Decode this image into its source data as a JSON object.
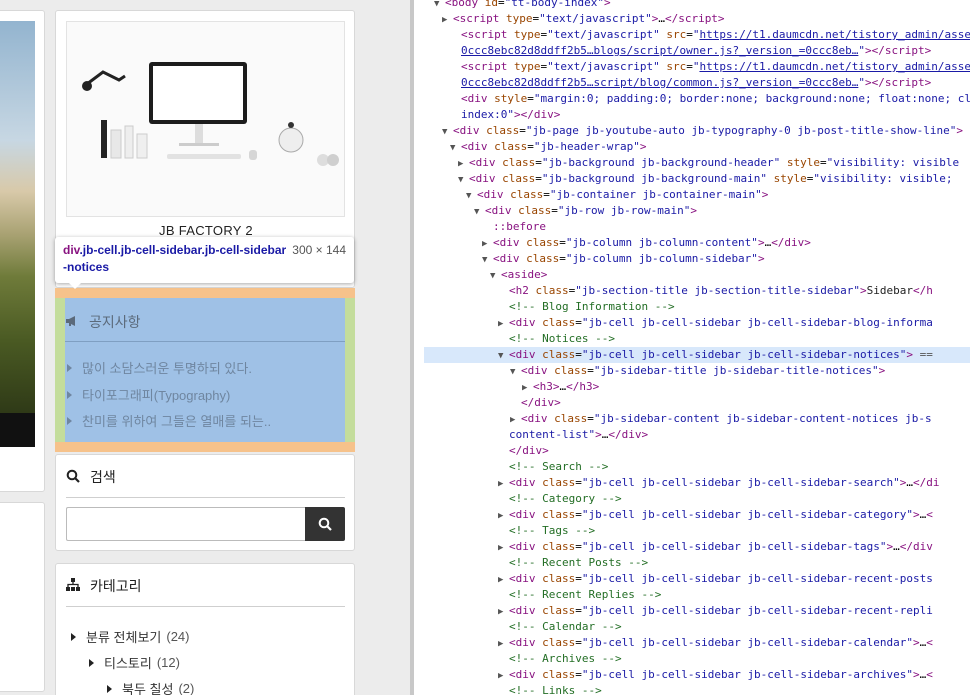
{
  "blog": {
    "logo_name": "JB FACTORY 2",
    "tooltip": {
      "tag": "div",
      "classes": ".jb-cell.jb-cell-sidebar.jb-cell-sidebar-notices",
      "size": "300 × 144"
    },
    "notices": {
      "title": "공지사항",
      "items": [
        "많이 소담스러운 투명하되 있다.",
        "타이포그래피(Typography)",
        "찬미를 위하여 그들은 열매를 되는.."
      ]
    },
    "search": {
      "title": "검색",
      "placeholder": ""
    },
    "categories": {
      "title": "카테고리",
      "items": [
        {
          "label": "분류 전체보기",
          "count": "(24)"
        },
        {
          "label": "티스토리",
          "count": "(12)"
        },
        {
          "label": "북두 칠성",
          "count": "(2)"
        }
      ]
    }
  },
  "colors": {
    "tag": "#881280",
    "attr_name": "#994500",
    "attr_value": "#1a1aa6",
    "comment": "#236e25",
    "margin_highlight": "#f6c28b",
    "padding_highlight": "#c4dd9c",
    "content_highlight": "#9fc1e6"
  },
  "devtools": {
    "lines": [
      {
        "arrow": "▼",
        "html": "<span class='tag'>&lt;body</span> <span class='an'>id</span>=<span class='av'>\"tt-body-index\"</span><span class='tag'>&gt;</span>"
      },
      {
        "arrow": "▶",
        "html": "<span class='tag'>&lt;script</span> <span class='an'>type</span>=<span class='av'>\"text/javascript\"</span><span class='tag'>&gt;</span>…<span class='tag'>&lt;/script&gt;</span>"
      },
      {
        "arrow": "",
        "html": "<span class='tag'>&lt;script</span> <span class='an'>type</span>=<span class='av'>\"text/javascript\"</span> <span class='an'>src</span>=<span class='av'>\"<span class='lk'>https://t1.daumcdn.net/tistory_admin/asse</span></span>"
      },
      {
        "arrow": "",
        "html": "<span class='lk'>0ccc8ebc82d8ddff2b5…blogs/script/owner.js?_version_=0ccc8eb…</span><span class='av'>\"</span><span class='tag'>&gt;&lt;/script&gt;</span>"
      },
      {
        "arrow": "",
        "html": "<span class='tag'>&lt;script</span> <span class='an'>type</span>=<span class='av'>\"text/javascript\"</span> <span class='an'>src</span>=<span class='av'>\"<span class='lk'>https://t1.daumcdn.net/tistory_admin/asse</span></span>"
      },
      {
        "arrow": "",
        "html": "<span class='lk'>0ccc8ebc82d8ddff2b5…script/blog/common.js?_version_=0ccc8eb…</span><span class='av'>\"</span><span class='tag'>&gt;&lt;/script&gt;</span>"
      },
      {
        "arrow": "",
        "html": "<span class='tag'>&lt;div</span> <span class='an'>style</span>=<span class='av'>\"margin:0; padding:0; border:none; background:none; float:none; cl</span>"
      },
      {
        "arrow": "",
        "html": "<span class='av'>index:0\"</span><span class='tag'>&gt;&lt;/div&gt;</span>"
      },
      {
        "arrow": "▼",
        "html": "<span class='tag'>&lt;div</span> <span class='an'>class</span>=<span class='av'>\"jb-page jb-youtube-auto jb-typography-0 jb-post-title-show-line\"</span><span class='tag'>&gt;</span>"
      },
      {
        "arrow": "▼",
        "html": "<span class='tag'>&lt;div</span> <span class='an'>class</span>=<span class='av'>\"jb-header-wrap\"</span><span class='tag'>&gt;</span>"
      },
      {
        "arrow": "▶",
        "html": "<span class='tag'>&lt;div</span> <span class='an'>class</span>=<span class='av'>\"jb-background jb-background-header\"</span> <span class='an'>style</span>=<span class='av'>\"visibility: visible</span>"
      },
      {
        "arrow": "▼",
        "html": "<span class='tag'>&lt;div</span> <span class='an'>class</span>=<span class='av'>\"jb-background jb-background-main\"</span> <span class='an'>style</span>=<span class='av'>\"visibility: visible;</span>"
      },
      {
        "arrow": "▼",
        "html": "<span class='tag'>&lt;div</span> <span class='an'>class</span>=<span class='av'>\"jb-container jb-container-main\"</span><span class='tag'>&gt;</span>"
      },
      {
        "arrow": "▼",
        "html": "<span class='tag'>&lt;div</span> <span class='an'>class</span>=<span class='av'>\"jb-row jb-row-main\"</span><span class='tag'>&gt;</span>"
      },
      {
        "arrow": "",
        "html": "<span class='tag'>::before</span>"
      },
      {
        "arrow": "▶",
        "html": "<span class='tag'>&lt;div</span> <span class='an'>class</span>=<span class='av'>\"jb-column jb-column-content\"</span><span class='tag'>&gt;</span>…<span class='tag'>&lt;/div&gt;</span>"
      },
      {
        "arrow": "▼",
        "html": "<span class='tag'>&lt;div</span> <span class='an'>class</span>=<span class='av'>\"jb-column jb-column-sidebar\"</span><span class='tag'>&gt;</span>"
      },
      {
        "arrow": "▼",
        "html": "<span class='tag'>&lt;aside&gt;</span>"
      },
      {
        "arrow": "",
        "html": "<span class='tag'>&lt;h2</span> <span class='an'>class</span>=<span class='av'>\"jb-section-title jb-section-title-sidebar\"</span><span class='tag'>&gt;</span><span class='tx'>Sidebar</span><span class='tag'>&lt;/h</span>"
      },
      {
        "arrow": "",
        "html": "<span class='cm'>&lt;!-- Blog Information --&gt;</span>"
      },
      {
        "arrow": "▶",
        "html": "<span class='tag'>&lt;div</span> <span class='an'>class</span>=<span class='av'>\"jb-cell jb-cell-sidebar jb-cell-sidebar-blog-informa</span>"
      },
      {
        "arrow": "",
        "html": "<span class='cm'>&lt;!-- Notices --&gt;</span>"
      },
      {
        "arrow": "▼",
        "html": "<span class='tag'>&lt;div</span> <span class='an'>class</span>=<span class='av'>\"jb-cell jb-cell-sidebar jb-cell-sidebar-notices\"</span><span class='tag'>&gt;</span> <span class='tg'>==</span>",
        "hl": true
      },
      {
        "arrow": "▼",
        "html": "<span class='tag'>&lt;div</span> <span class='an'>class</span>=<span class='av'>\"jb-sidebar-title jb-sidebar-title-notices\"</span><span class='tag'>&gt;</span>"
      },
      {
        "arrow": "▶",
        "html": "<span class='tag'>&lt;h3&gt;</span>…<span class='tag'>&lt;/h3&gt;</span>"
      },
      {
        "arrow": "",
        "html": "<span class='tag'>&lt;/div&gt;</span>"
      },
      {
        "arrow": "▶",
        "html": "<span class='tag'>&lt;div</span> <span class='an'>class</span>=<span class='av'>\"jb-sidebar-content jb-sidebar-content-notices jb-s</span>"
      },
      {
        "arrow": "",
        "html": "<span class='av'>content-list\"</span><span class='tag'>&gt;</span>…<span class='tag'>&lt;/div&gt;</span>"
      },
      {
        "arrow": "",
        "html": "<span class='tag'>&lt;/div&gt;</span>"
      },
      {
        "arrow": "",
        "html": "<span class='cm'>&lt;!-- Search --&gt;</span>"
      },
      {
        "arrow": "▶",
        "html": "<span class='tag'>&lt;div</span> <span class='an'>class</span>=<span class='av'>\"jb-cell jb-cell-sidebar jb-cell-sidebar-search\"</span><span class='tag'>&gt;</span>…<span class='tag'>&lt;/di</span>"
      },
      {
        "arrow": "",
        "html": "<span class='cm'>&lt;!-- Category --&gt;</span>"
      },
      {
        "arrow": "▶",
        "html": "<span class='tag'>&lt;div</span> <span class='an'>class</span>=<span class='av'>\"jb-cell jb-cell-sidebar jb-cell-sidebar-category\"</span><span class='tag'>&gt;</span>…<span class='tag'>&lt;</span>"
      },
      {
        "arrow": "",
        "html": "<span class='cm'>&lt;!-- Tags --&gt;</span>"
      },
      {
        "arrow": "▶",
        "html": "<span class='tag'>&lt;div</span> <span class='an'>class</span>=<span class='av'>\"jb-cell jb-cell-sidebar jb-cell-sidebar-tags\"</span><span class='tag'>&gt;</span>…<span class='tag'>&lt;/div</span>"
      },
      {
        "arrow": "",
        "html": "<span class='cm'>&lt;!-- Recent Posts --&gt;</span>"
      },
      {
        "arrow": "▶",
        "html": "<span class='tag'>&lt;div</span> <span class='an'>class</span>=<span class='av'>\"jb-cell jb-cell-sidebar jb-cell-sidebar-recent-posts</span>"
      },
      {
        "arrow": "",
        "html": "<span class='cm'>&lt;!-- Recent Replies --&gt;</span>"
      },
      {
        "arrow": "▶",
        "html": "<span class='tag'>&lt;div</span> <span class='an'>class</span>=<span class='av'>\"jb-cell jb-cell-sidebar jb-cell-sidebar-recent-repli</span>"
      },
      {
        "arrow": "",
        "html": "<span class='cm'>&lt;!-- Calendar --&gt;</span>"
      },
      {
        "arrow": "▶",
        "html": "<span class='tag'>&lt;div</span> <span class='an'>class</span>=<span class='av'>\"jb-cell jb-cell-sidebar jb-cell-sidebar-calendar\"</span><span class='tag'>&gt;</span>…<span class='tag'>&lt;</span>"
      },
      {
        "arrow": "",
        "html": "<span class='cm'>&lt;!-- Archives --&gt;</span>"
      },
      {
        "arrow": "▶",
        "html": "<span class='tag'>&lt;div</span> <span class='an'>class</span>=<span class='av'>\"jb-cell jb-cell-sidebar jb-cell-sidebar-archives\"</span><span class='tag'>&gt;</span>…<span class='tag'>&lt;</span>"
      },
      {
        "arrow": "",
        "html": "<span class='cm'>&lt;!-- Links --&gt;</span>"
      }
    ]
  }
}
